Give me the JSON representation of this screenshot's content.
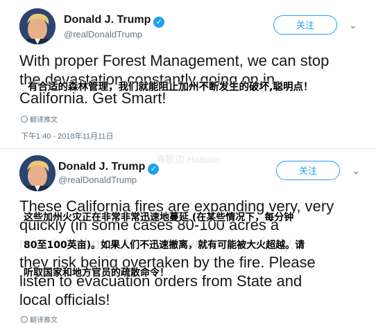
{
  "tweets": [
    {
      "author_name": "Donald J. Trump",
      "author_handle": "@realDonaldTrump",
      "follow_label": "关注",
      "text_lines": [
        "With proper Forest Management, we can stop",
        "the devastation constantly going on in",
        "California. Get Smart!"
      ],
      "caption_lines": [
        "有合适的森林管理，我们就能阻止加州不断发生的破坏,聪明点！"
      ],
      "translate_label": "翻译推文",
      "timestamp": "下午1:40 - 2018年11月11日"
    },
    {
      "author_name": "Donald J. Trump",
      "author_handle": "@realDonaldTrump",
      "follow_label": "关注",
      "text_lines": [
        "These California fires are expanding very, very",
        "quickly (in some cases 80-100 acres a",
        "minute). If people don't evacuate quickly,",
        "they risk being overtaken by the fire. Please",
        "listen to evacuation orders from State and",
        "local officials!"
      ],
      "caption_lines": [
        "这些加州火灾正在非常非常迅速地蔓延 (在某些情况下，每分钟",
        "80至100英亩)。如果人们不迅速撤离，就有可能被大火超越。请",
        "听取国家和地方官员的疏散命令！"
      ],
      "translate_label": "翻译推文"
    }
  ],
  "watermark": "海那边 Haibian",
  "colors": {
    "accent": "#1da1f2",
    "secondary_text": "#657786",
    "text": "#14171a"
  },
  "icons": {
    "verified": "verified-badge-icon",
    "chevron": "chevron-down-icon",
    "translate": "globe-icon"
  }
}
